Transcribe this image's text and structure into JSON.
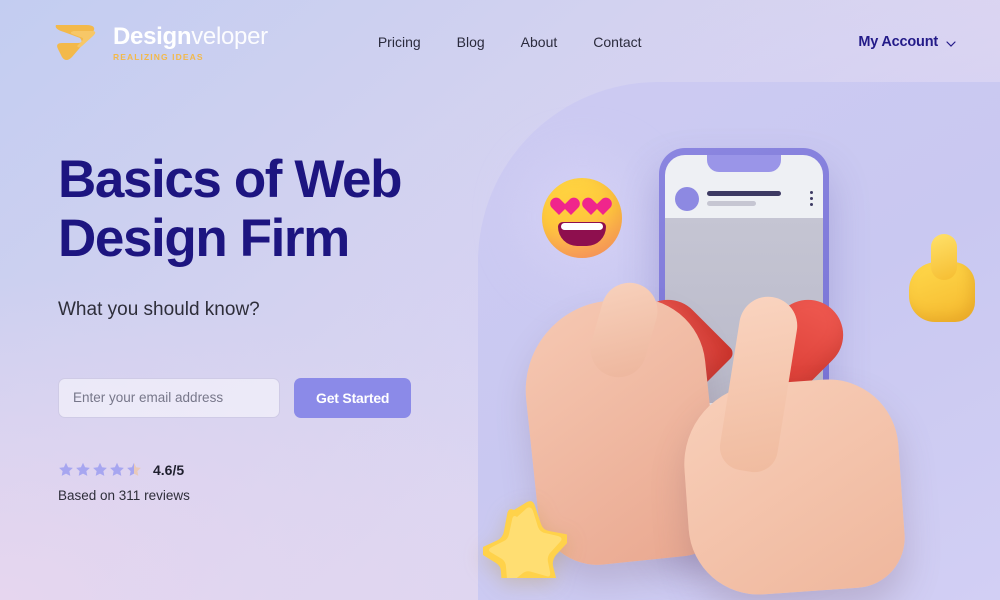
{
  "header": {
    "logo": {
      "word_bold": "Design",
      "word_light": "veloper",
      "tagline": "REALIZING IDEAS",
      "mark_icon": "arrow-chevron-logo-icon",
      "color": "#f3b94a"
    },
    "nav": [
      {
        "label": "Pricing"
      },
      {
        "label": "Blog"
      },
      {
        "label": "About"
      },
      {
        "label": "Contact"
      }
    ],
    "account": {
      "label": "My Account",
      "chevron_icon": "chevron-down-icon",
      "color": "#231a88"
    }
  },
  "hero": {
    "title_line1": "Basics of Web",
    "title_line2": "Design Firm",
    "title_color": "#1d1580",
    "subtitle": "What you should know?",
    "form": {
      "email_placeholder": "Enter your email address",
      "email_value": "",
      "submit_label": "Get Started",
      "submit_color": "#8b8ae8"
    },
    "rating": {
      "score": "4.6/5",
      "stars_filled": 4.5,
      "stars_total": 5,
      "star_color": "#a7a6f0",
      "reviews_text": "Based on 311 reviews"
    }
  },
  "illustration": {
    "name": "3d-hand-tapping-heart-on-phone",
    "panel_color": "#cdcbf2",
    "phone": {
      "frame_color": "#8b86e0",
      "screen_color": "#eef0f4",
      "post_actions": [
        "like-heart-icon",
        "comment-bubble-icon",
        "send-plane-icon"
      ],
      "menu_icon": "three-dots-icon",
      "avatar_icon": "avatar-circle-icon"
    },
    "floating": [
      {
        "name": "heart-eyes-emoji",
        "color": "#ffc93c"
      },
      {
        "name": "thumbs-up-emoji",
        "color": "#f5b82e"
      },
      {
        "name": "star-3d-icon",
        "color": "#ffd24a"
      },
      {
        "name": "big-heart-3d-icon",
        "color": "#e8413c"
      }
    ]
  }
}
